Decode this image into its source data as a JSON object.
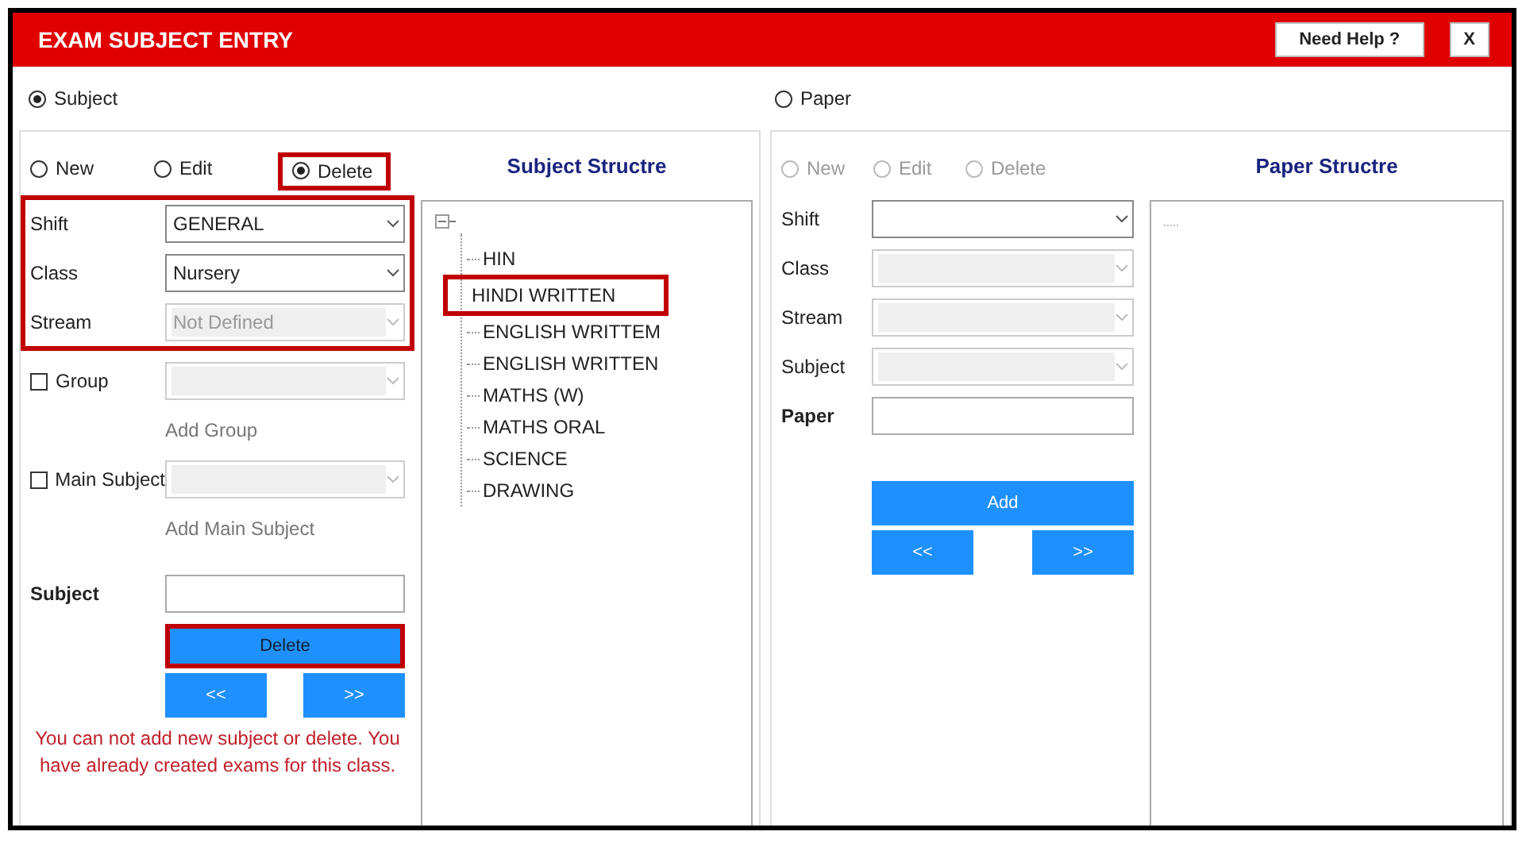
{
  "window": {
    "title": "EXAM SUBJECT ENTRY",
    "buttons": [
      {
        "label": "Need Help ?",
        "kind": "help"
      },
      {
        "label": "X",
        "kind": "close"
      }
    ]
  },
  "sections": [
    {
      "label": "Subject",
      "selected": true
    },
    {
      "label": "Paper",
      "selected": false
    }
  ],
  "panels": [
    {
      "modes_disabled": false,
      "modes": [
        {
          "label": "New",
          "selected": false,
          "highlighted": false
        },
        {
          "label": "Edit",
          "selected": false,
          "highlighted": false
        },
        {
          "label": "Delete",
          "selected": true,
          "highlighted": true
        }
      ],
      "rows": [
        {
          "kind": "group",
          "highlighted": true,
          "rows": [
            {
              "kind": "select",
              "label": "Shift",
              "value": "GENERAL",
              "disabled": false
            },
            {
              "kind": "select",
              "label": "Class",
              "value": "Nursery",
              "disabled": false
            },
            {
              "kind": "select",
              "label": "Stream",
              "value": "Not Defined",
              "disabled": true
            }
          ]
        },
        {
          "kind": "check-select",
          "label": "Group",
          "checked": false,
          "disabled": true
        },
        {
          "kind": "link",
          "label": "Add Group"
        },
        {
          "kind": "check-select",
          "label": "Main Subject",
          "checked": false,
          "disabled": true
        },
        {
          "kind": "link",
          "label": "Add Main Subject"
        },
        {
          "kind": "input",
          "label": "Subject"
        },
        {
          "kind": "button",
          "label": "Delete",
          "highlighted": true
        },
        {
          "kind": "pager",
          "buttons": [
            "<<",
            ">>"
          ]
        },
        {
          "kind": "message",
          "text": "You can not add new subject or delete. You have already created exams for this class."
        }
      ],
      "structure": {
        "title": "Subject Structre",
        "tree": [
          {
            "expanded": true,
            "children": [
              {
                "label": "HIN",
                "highlighted": false
              },
              {
                "label": "HINDI WRITTEN",
                "highlighted": true
              },
              {
                "label": "ENGLISH WRITTEM",
                "highlighted": false
              },
              {
                "label": "ENGLISH WRITTEN",
                "highlighted": false
              },
              {
                "label": "MATHS (W)",
                "highlighted": false
              },
              {
                "label": "MATHS ORAL",
                "highlighted": false
              },
              {
                "label": "SCIENCE",
                "highlighted": false
              },
              {
                "label": "DRAWING",
                "highlighted": false
              }
            ]
          }
        ]
      }
    },
    {
      "modes_disabled": true,
      "modes": [
        {
          "label": "New",
          "selected": false,
          "highlighted": false
        },
        {
          "label": "Edit",
          "selected": false,
          "highlighted": false
        },
        {
          "label": "Delete",
          "selected": false,
          "highlighted": false
        }
      ],
      "rows": [
        {
          "kind": "select",
          "label": "Shift",
          "disabled": false
        },
        {
          "kind": "select",
          "label": "Class",
          "disabled": true
        },
        {
          "kind": "select",
          "label": "Stream",
          "disabled": true
        },
        {
          "kind": "select",
          "label": "Subject",
          "disabled": true
        },
        {
          "kind": "input",
          "label": "Paper"
        },
        {
          "kind": "button",
          "label": "Add",
          "highlighted": false
        },
        {
          "kind": "pager",
          "buttons": [
            "<<",
            ">>"
          ]
        }
      ],
      "structure": {
        "title": "Paper Structre",
        "tree": [
          {
            "expanded": false
          }
        ]
      }
    }
  ]
}
